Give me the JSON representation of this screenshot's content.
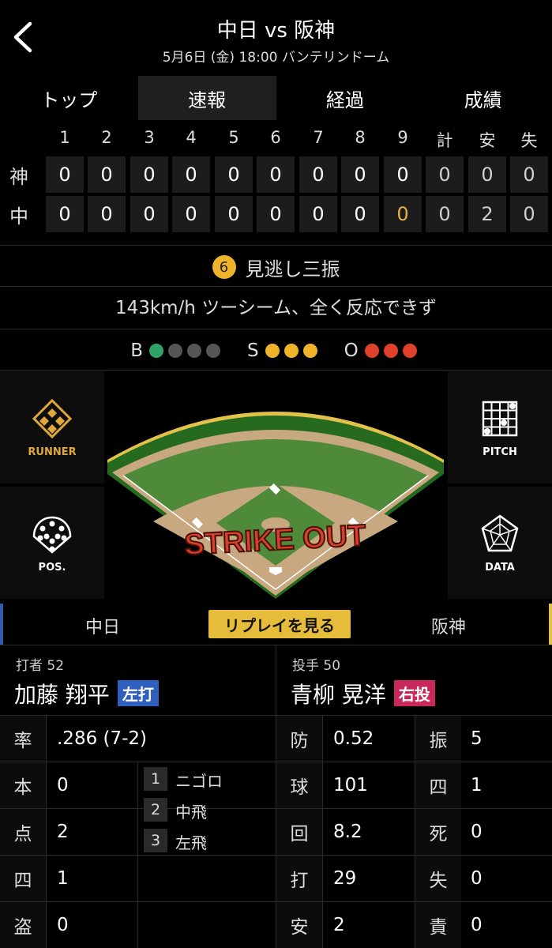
{
  "header": {
    "title": "中日 vs 阪神",
    "subtitle": "5月6日 (金) 18:00 バンテリンドーム"
  },
  "tabs": [
    {
      "label": "トップ"
    },
    {
      "label": "速報"
    },
    {
      "label": "経過"
    },
    {
      "label": "成績"
    }
  ],
  "scoreboard": {
    "headers": [
      "1",
      "2",
      "3",
      "4",
      "5",
      "6",
      "7",
      "8",
      "9",
      "計",
      "安",
      "失"
    ],
    "teams": [
      {
        "label": "神",
        "cells": [
          "0",
          "0",
          "0",
          "0",
          "0",
          "0",
          "0",
          "0",
          "0",
          "0",
          "0",
          "0"
        ]
      },
      {
        "label": "中",
        "cells": [
          "0",
          "0",
          "0",
          "0",
          "0",
          "0",
          "0",
          "0",
          "0",
          "0",
          "2",
          "0"
        ]
      }
    ]
  },
  "play": {
    "number": "6",
    "result": "見逃し三振",
    "description": "143km/h ツーシーム、全く反応できず"
  },
  "count": {
    "b_label": "B",
    "s_label": "S",
    "o_label": "O",
    "balls": 1,
    "strikes": 3,
    "outs": 3,
    "colors": {
      "ball": "#2fa46a",
      "strike": "#f0b42a",
      "out": "#e0412a",
      "empty": "#555555"
    }
  },
  "side_buttons": {
    "runner": "RUNNER",
    "pitch": "PITCH",
    "pos": "POS.",
    "data": "DATA"
  },
  "field": {
    "overlay_text": "STRIKE OUT"
  },
  "replay": {
    "home": "中日",
    "button": "リプレイを見る",
    "away": "阪神"
  },
  "batter": {
    "role": "打者 52",
    "name": "加藤 翔平",
    "tag": "左打",
    "avg_label": "率",
    "avg": ".286 (7-2)",
    "stats": [
      {
        "label": "本",
        "value": "0"
      },
      {
        "label": "点",
        "value": "2"
      },
      {
        "label": "四",
        "value": "1"
      },
      {
        "label": "盗",
        "value": "0"
      }
    ],
    "at_bats": [
      {
        "num": "1",
        "text": "ニゴロ"
      },
      {
        "num": "2",
        "text": "中飛"
      },
      {
        "num": "3",
        "text": "左飛"
      }
    ]
  },
  "pitcher": {
    "role": "投手 50",
    "name": "青柳 晃洋",
    "tag": "右投",
    "stats_left": [
      {
        "label": "防",
        "value": "0.52"
      },
      {
        "label": "球",
        "value": "101"
      },
      {
        "label": "回",
        "value": "8.2"
      },
      {
        "label": "打",
        "value": "29"
      },
      {
        "label": "安",
        "value": "2"
      }
    ],
    "stats_right": [
      {
        "label": "振",
        "value": "5"
      },
      {
        "label": "四",
        "value": "1"
      },
      {
        "label": "死",
        "value": "0"
      },
      {
        "label": "失",
        "value": "0"
      },
      {
        "label": "責",
        "value": "0"
      }
    ]
  }
}
